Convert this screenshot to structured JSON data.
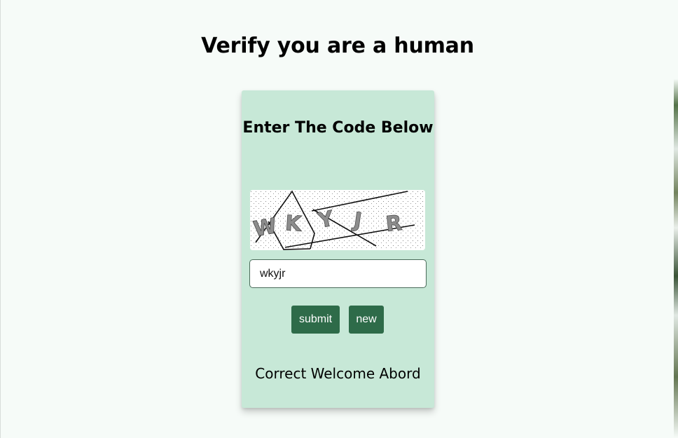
{
  "page": {
    "title": "Verify you are a human",
    "background": "#f6fbf8"
  },
  "card": {
    "title": "Enter The Code Below",
    "background": "#c7e8d7",
    "captcha_text": "WKYJR",
    "input_value": "wkyjr",
    "submit_label": "submit",
    "new_label": "new",
    "status_message": "Correct Welcome Abord",
    "button_color": "#2e6b49"
  }
}
